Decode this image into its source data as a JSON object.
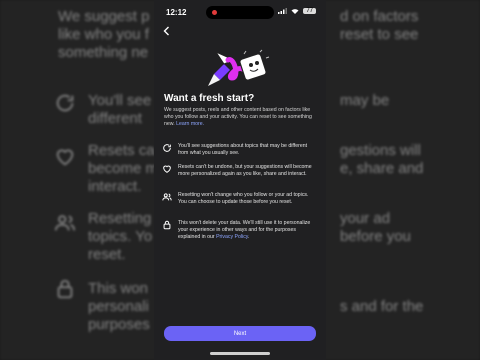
{
  "status": {
    "time": "12:12",
    "battery": "77"
  },
  "screen": {
    "title": "Want a fresh start?",
    "intro": "We suggest posts, reels and other content based on factors like who you follow and your activity. You can reset to see something new.",
    "learn_more": "Learn more.",
    "items": [
      {
        "icon": "refresh-icon",
        "text": "You'll see suggestions about topics that may be different from what you usually see."
      },
      {
        "icon": "heart-icon",
        "text": "Resets can't be undone, but your suggestions will become more personalized again as you like, share and interact."
      },
      {
        "icon": "people-icon",
        "text": "Resetting won't change who you follow or your ad topics. You can choose to update those before you reset."
      },
      {
        "icon": "lock-icon",
        "text_before": "This won't delete your data. We'll still use it to personalize your experience in other ways and for the purposes explained in our",
        "policy_link": "Privacy Policy",
        "text_after": "."
      }
    ],
    "next_label": "Next"
  },
  "background": {
    "line1_left": "We suggest p",
    "line1_right": "d on factors",
    "line2_left": "like who you f",
    "line2_right": "reset to see",
    "line3_left": "something ne",
    "b1_left": "You'll see",
    "b1_right": "may be",
    "b1b": "different",
    "b2_left": "Resets ca",
    "b2_right": "gestions will",
    "b2b": "become m",
    "b2b_right": "e, share and",
    "b2c": "interact.",
    "b3_left": "Resetting",
    "b3_right": "your ad",
    "b3b": "topics. Yo",
    "b3b_right": "before you",
    "b3c": "reset.",
    "b4_left": "This won",
    "b4b": "personali",
    "b4b_right": "s and for the",
    "b4c": "purposes"
  }
}
